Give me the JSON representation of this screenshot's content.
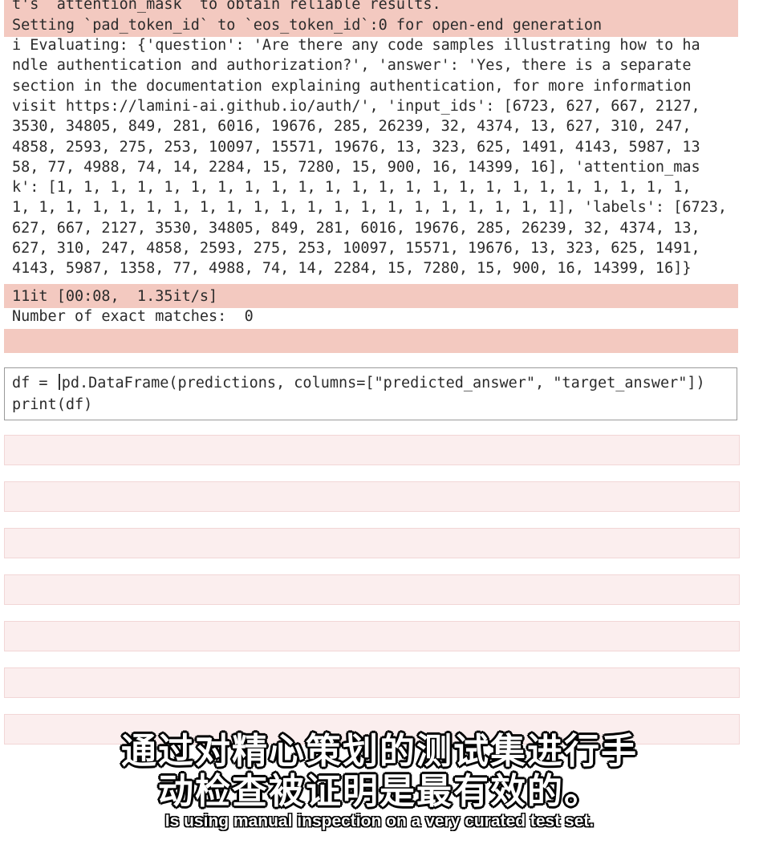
{
  "output_top": {
    "lines": [
      "t's `attention_mask` to obtain reliable results.",
      "Setting `pad_token_id` to `eos_token_id`:0 for open-end generation"
    ]
  },
  "output_main": {
    "lines": [
      "i Evaluating: {'question': 'Are there any code samples illustrating how to ha",
      "ndle authentication and authorization?', 'answer': 'Yes, there is a separate",
      "section in the documentation explaining authentication, for more information",
      "visit https://lamini-ai.github.io/auth/', 'input_ids': [6723, 627, 667, 2127,",
      "3530, 34805, 849, 281, 6016, 19676, 285, 26239, 32, 4374, 13, 627, 310, 247,",
      "4858, 2593, 275, 253, 10097, 15571, 19676, 13, 323, 625, 1491, 4143, 5987, 13",
      "58, 77, 4988, 74, 14, 2284, 15, 7280, 15, 900, 16, 14399, 16], 'attention_mas",
      "k': [1, 1, 1, 1, 1, 1, 1, 1, 1, 1, 1, 1, 1, 1, 1, 1, 1, 1, 1, 1, 1, 1, 1, 1,",
      "1, 1, 1, 1, 1, 1, 1, 1, 1, 1, 1, 1, 1, 1, 1, 1, 1, 1, 1, 1, 1], 'labels': [6723,",
      "627, 667, 2127, 3530, 34805, 849, 281, 6016, 19676, 285, 26239, 32, 4374, 13,",
      "627, 310, 247, 4858, 2593, 275, 253, 10097, 15571, 19676, 13, 323, 625, 1491,",
      "4143, 5987, 1358, 77, 4988, 74, 14, 2284, 15, 7280, 15, 900, 16, 14399, 16]}"
    ]
  },
  "progress": {
    "text": "11it [00:08,  1.35it/s]"
  },
  "result": {
    "text": "Number of exact matches:  0"
  },
  "code_cell": {
    "line1_before": "df = ",
    "line1_after": "pd.DataFrame(predictions, columns=[\"predicted_answer\", \"target_answer\"])",
    "line2": "print(df)"
  },
  "subtitles": {
    "zh_line1": "通过对精心策划的测试集进行手",
    "zh_line2": "动检查被证明是最有效的。",
    "en": "Is using manual inspection on a very curated test set."
  },
  "colors": {
    "stderr_highlight": "#f3c9c0",
    "empty_cell": "#fbeeee"
  }
}
